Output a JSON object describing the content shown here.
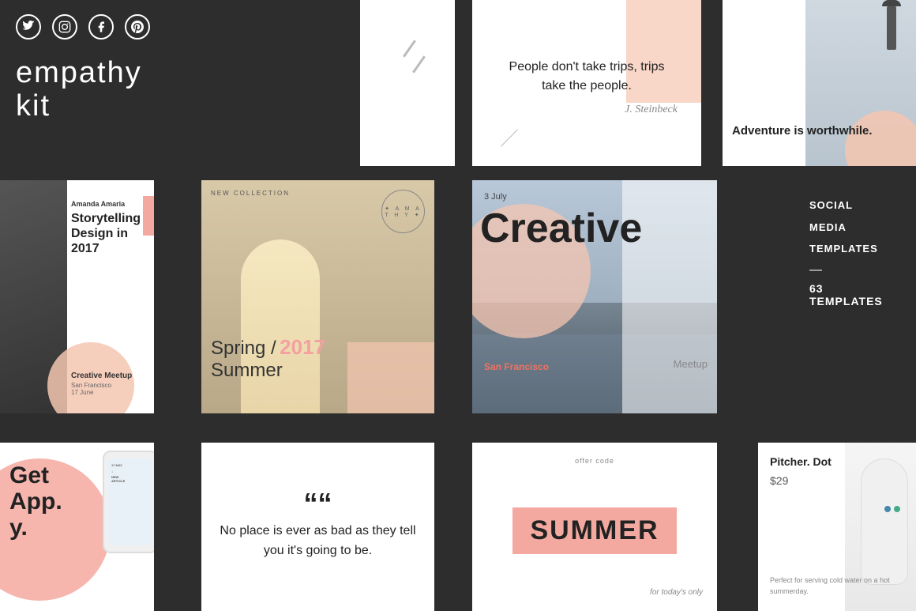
{
  "brand": {
    "title_line1": "empathy",
    "title_line2": "kit"
  },
  "social_icons": [
    {
      "name": "twitter",
      "symbol": "𝕏"
    },
    {
      "name": "instagram",
      "symbol": "◯"
    },
    {
      "name": "facebook",
      "symbol": "f"
    },
    {
      "name": "pinterest",
      "symbol": "p"
    }
  ],
  "sidebar_right": {
    "line1": "SOCIAL",
    "line2": "MEDIA",
    "line3": "TEMPLATES",
    "dash": "—",
    "count": "63 TEMPLATES"
  },
  "card_top_quote": {
    "text": "People don't take trips, trips take the people.",
    "author": "J. Steinbeck"
  },
  "card_top_adventure": {
    "text": "Adventure is worthwhile."
  },
  "card_mid_storytelling": {
    "author": "Amanda Amaria",
    "title": "Storytelling Design in 2017",
    "event": "Creative Meetup",
    "location": "San Francisco",
    "date": "17 June"
  },
  "card_mid_spring": {
    "label": "NEW COLLECTION",
    "text1": "Spring /",
    "year": "2017",
    "text2": "Summer"
  },
  "card_mid_creative": {
    "date": "3 July",
    "title": "Creative",
    "location": "San Francisco",
    "subtitle": "Meetup"
  },
  "card_bot_getapp": {
    "text": "Get\nApp.\ny."
  },
  "card_bot_quote": {
    "quote_mark": "““",
    "text": "No place is ever as bad as they tell you it's going to be."
  },
  "card_bot_summer": {
    "offer_label": "offer code",
    "summer": "SUMMER",
    "today": "for today's only"
  },
  "card_bot_pitcher": {
    "title": "Pitcher. Dot",
    "price": "$29",
    "description": "Perfect for serving cold water on a hot summerday."
  }
}
